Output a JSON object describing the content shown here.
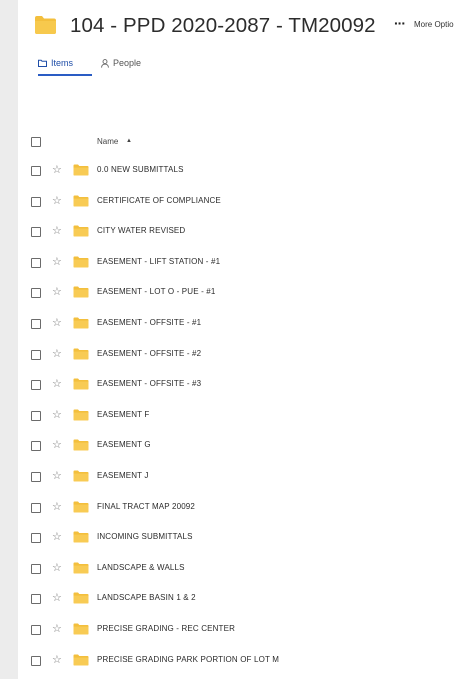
{
  "header": {
    "title": "104 - PPD 2020-2087 - TM20092",
    "more_dots": "···",
    "more_label": "More Optio"
  },
  "tabs": {
    "items": "Items",
    "people": "People"
  },
  "columns": {
    "name": "Name",
    "sort": "▲"
  },
  "colors": {
    "folder": "#f3bf3d",
    "accent": "#2a5cc4"
  },
  "rows": [
    {
      "label": "0.0 NEW SUBMITTALS"
    },
    {
      "label": "CERTIFICATE OF COMPLIANCE"
    },
    {
      "label": "CITY WATER REVISED"
    },
    {
      "label": "EASEMENT - LIFT STATION - #1"
    },
    {
      "label": "EASEMENT - LOT O - PUE - #1"
    },
    {
      "label": "EASEMENT - OFFSITE - #1"
    },
    {
      "label": "EASEMENT - OFFSITE - #2"
    },
    {
      "label": "EASEMENT - OFFSITE - #3"
    },
    {
      "label": "EASEMENT F"
    },
    {
      "label": "EASEMENT G"
    },
    {
      "label": "EASEMENT J"
    },
    {
      "label": "FINAL TRACT MAP 20092"
    },
    {
      "label": "INCOMING SUBMITTALS"
    },
    {
      "label": "LANDSCAPE & WALLS"
    },
    {
      "label": "LANDSCAPE BASIN 1 & 2"
    },
    {
      "label": "PRECISE GRADING - REC CENTER"
    },
    {
      "label": "PRECISE GRADING PARK PORTION OF LOT M"
    }
  ]
}
